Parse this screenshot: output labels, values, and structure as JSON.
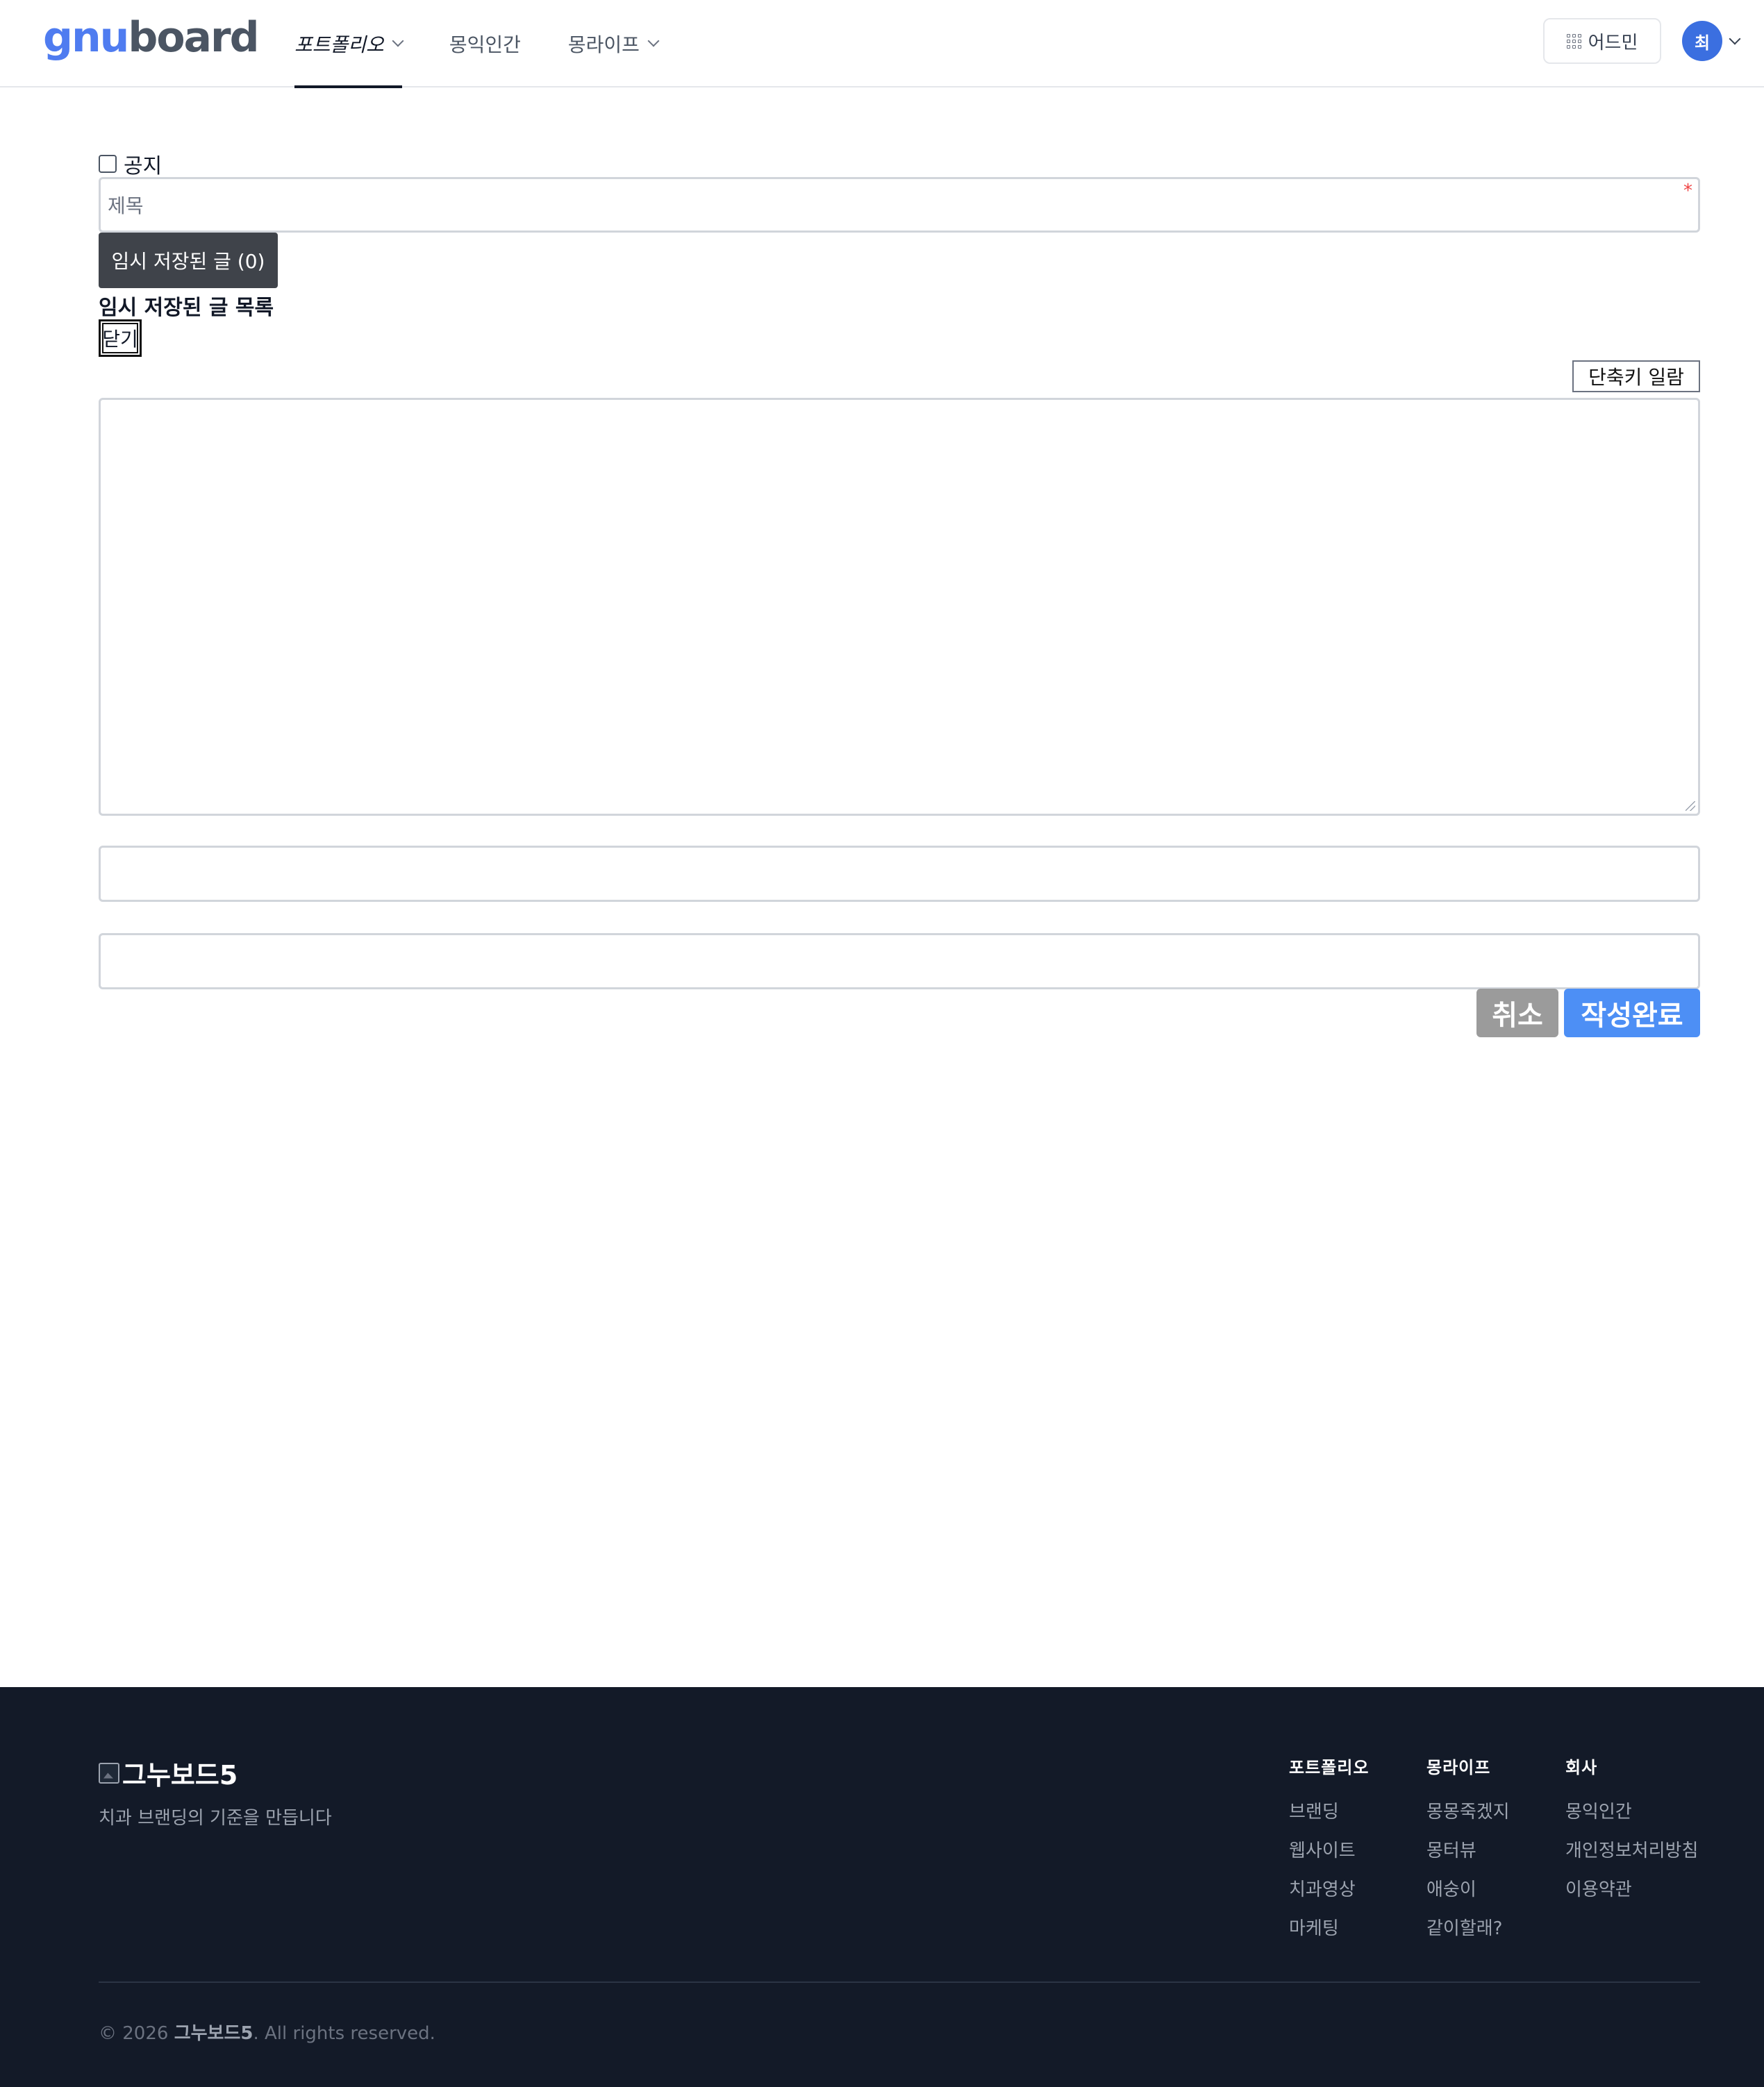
{
  "header": {
    "logo_part1": "gnu",
    "logo_part2": "board",
    "nav": [
      {
        "label": "포트폴리오",
        "has_dropdown": true,
        "active": true
      },
      {
        "label": "몽익인간",
        "has_dropdown": false,
        "active": false
      },
      {
        "label": "몽라이프",
        "has_dropdown": true,
        "active": false
      }
    ],
    "admin_label": "어드민",
    "avatar_initial": "최"
  },
  "form": {
    "notice_label": "공지",
    "title_placeholder": "제목",
    "required_mark": "*",
    "temp_saved_button": "임시 저장된 글 (0)",
    "temp_saved_heading": "임시 저장된 글 목록",
    "close_button": "닫기",
    "shortcut_button": "단축키 일람",
    "cancel_button": "취소",
    "submit_button": "작성완료"
  },
  "footer": {
    "logo_alt": "그누보드5",
    "tagline": "치과 브랜딩의 기준을 만듭니다",
    "columns": [
      {
        "heading": "포트폴리오",
        "links": [
          "브랜딩",
          "웹사이트",
          "치과영상",
          "마케팅"
        ]
      },
      {
        "heading": "몽라이프",
        "links": [
          "몽몽죽겠지",
          "몽터뷰",
          "애숭이",
          "같이할래?"
        ]
      },
      {
        "heading": "회사",
        "links": [
          "몽익인간",
          "개인정보처리방침",
          "이용약관"
        ]
      }
    ],
    "copyright_prefix": "© 2026 ",
    "copyright_brand": "그누보드5",
    "copyright_suffix": ". All rights reserved."
  },
  "colors": {
    "accent": "#4d8ff5",
    "avatar_bg": "#3b6fe0",
    "footer_bg": "#131a28",
    "required": "#ef4444"
  },
  "icons": [
    "chevron-down-icon",
    "grid-icon",
    "resize-handle-icon",
    "broken-image-icon"
  ]
}
